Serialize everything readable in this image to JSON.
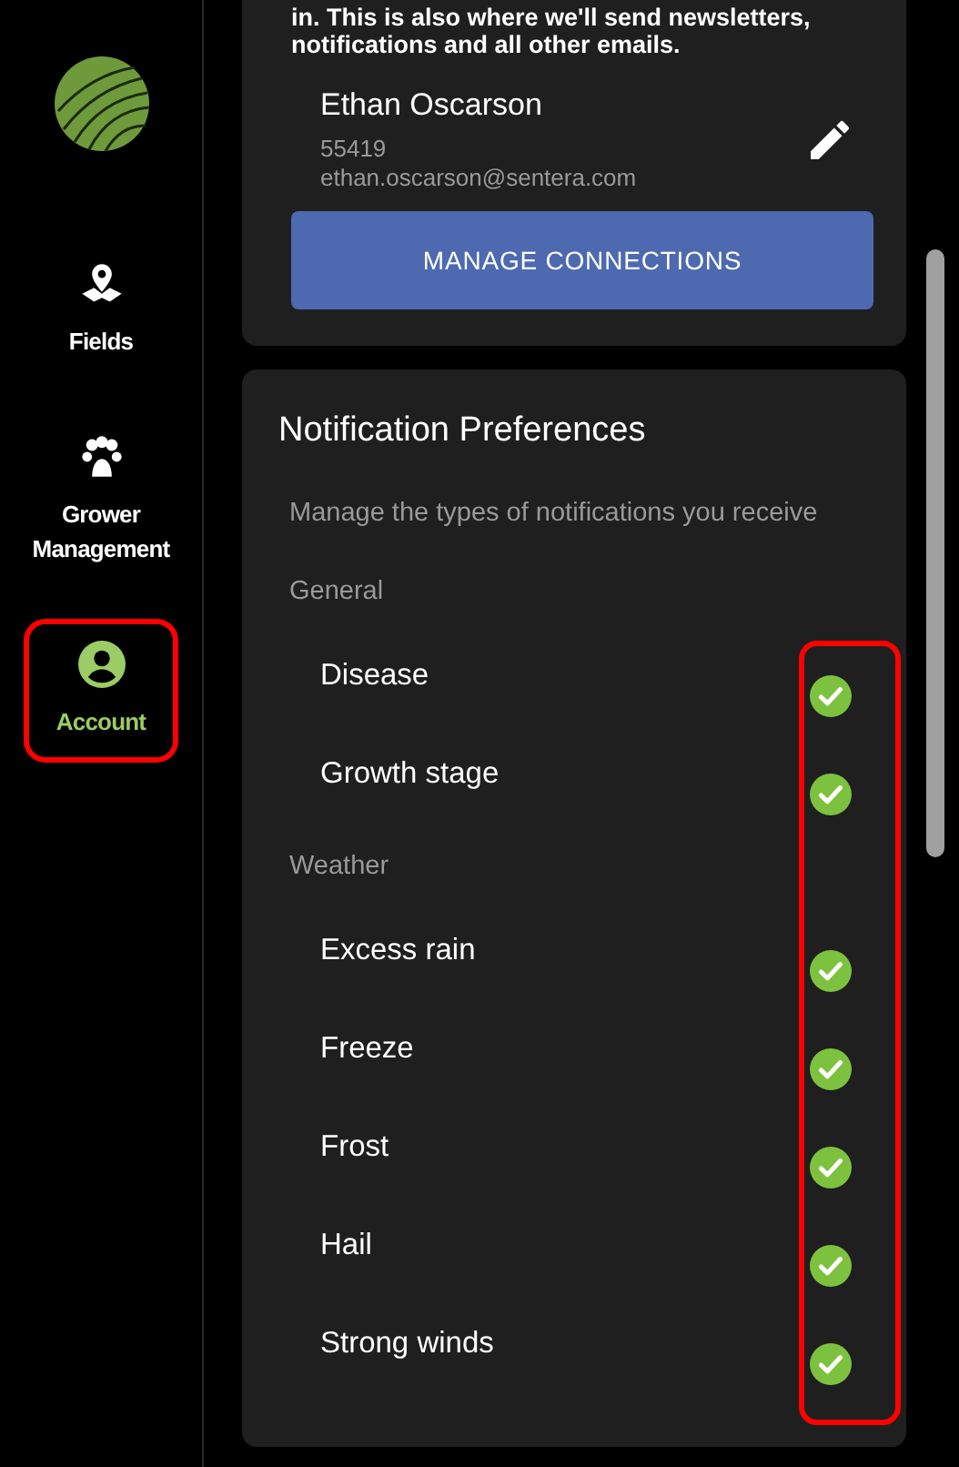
{
  "sidebar": {
    "items": [
      {
        "label": "Fields",
        "kind": "map",
        "selected": false,
        "highlighted": false
      },
      {
        "label": "Grower Management",
        "kind": "group",
        "selected": false,
        "highlighted": false
      },
      {
        "label": "Account",
        "kind": "person",
        "selected": true,
        "highlighted": true
      }
    ]
  },
  "account_card": {
    "text": "in. This is also where we'll send newsletters, notifications and all other emails.",
    "name": "Ethan Oscarson",
    "zip": "55419",
    "email": "ethan.oscarson@sentera.com",
    "button": "MANAGE CONNECTIONS"
  },
  "notification_preferences": {
    "title": "Notification Preferences",
    "description": "Manage the types of notifications you receive",
    "highlighted": true,
    "groups": [
      {
        "label": "General",
        "items": [
          {
            "label": "Disease",
            "checked": true
          },
          {
            "label": "Growth stage",
            "checked": true
          }
        ]
      },
      {
        "label": "Weather",
        "items": [
          {
            "label": "Excess rain",
            "checked": true
          },
          {
            "label": "Freeze",
            "checked": true
          },
          {
            "label": "Frost",
            "checked": true
          },
          {
            "label": "Hail",
            "checked": true
          },
          {
            "label": "Strong winds",
            "checked": true
          }
        ]
      }
    ]
  }
}
